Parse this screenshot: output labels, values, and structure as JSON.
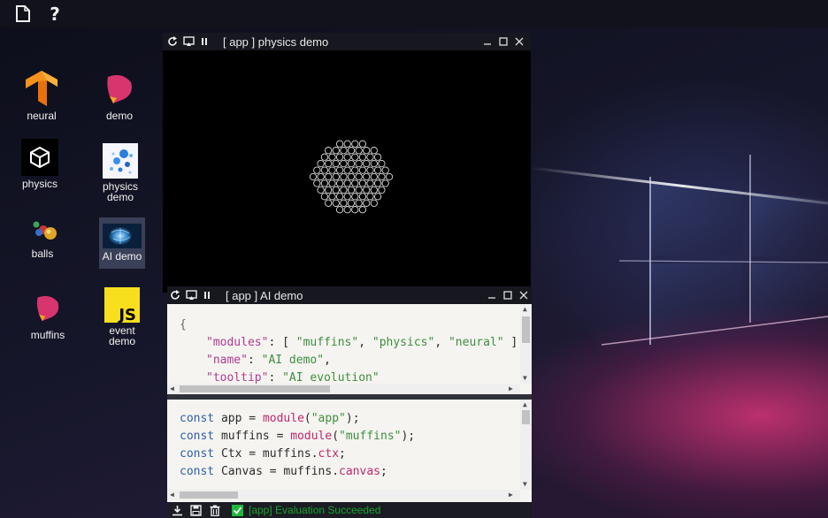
{
  "desktop": {
    "icons": [
      {
        "label": "neural",
        "icon": "tensorflow-icon"
      },
      {
        "label": "demo",
        "icon": "muffins-logo-icon"
      },
      {
        "label": "physics",
        "icon": "unity-cube-icon"
      },
      {
        "label": "physics demo",
        "icon": "particles-icon"
      },
      {
        "label": "balls",
        "icon": "balls-icon"
      },
      {
        "label": "AI demo",
        "icon": "ai-brain-icon",
        "selected": true
      },
      {
        "label": "muffins",
        "icon": "muffins-logo-icon"
      },
      {
        "label": "event demo",
        "icon": "javascript-icon"
      }
    ]
  },
  "topbar": {
    "icons": [
      "new-file-icon",
      "help-icon"
    ]
  },
  "physics_window": {
    "title": "[ app ] physics demo",
    "buttons": [
      "reload-icon",
      "cast-icon",
      "pause-icon",
      "minimize-icon",
      "maximize-icon",
      "close-icon"
    ]
  },
  "ai_window": {
    "title": "[ app ] AI demo",
    "json_lines": {
      "l1": "{",
      "l2_key": "\"modules\"",
      "l2_rest": ": [ ",
      "l2_s1": "\"muffins\"",
      "l2_c1": ", ",
      "l2_s2": "\"physics\"",
      "l2_c2": ", ",
      "l2_s3": "\"neural\"",
      "l2_end": " ],",
      "l3_key": "\"name\"",
      "l3_rest": ": ",
      "l3_val": "\"AI demo\"",
      "l3_end": ",",
      "l4_key": "\"tooltip\"",
      "l4_rest": ": ",
      "l4_val": "\"AI evolution\""
    },
    "code_lines": [
      {
        "kw": "const",
        "name": " app = ",
        "fn": "module",
        "open": "(",
        "str": "\"app\"",
        "close": ");"
      },
      {
        "kw": "const",
        "name": " muffins = ",
        "fn": "module",
        "open": "(",
        "str": "\"muffins\"",
        "close": ");"
      },
      {
        "kw": "const",
        "name": " Ctx = muffins.",
        "fn": "ctx",
        "open": "",
        "str": "",
        "close": ";"
      },
      {
        "kw": "const",
        "name": " Canvas = muffins.",
        "fn": "canvas",
        "open": "",
        "str": "",
        "close": ";"
      }
    ],
    "status": {
      "text": "[app] Evaluation Succeeded",
      "buttons": [
        "download-icon",
        "save-icon",
        "trash-icon"
      ],
      "check_icon": "check-icon"
    }
  },
  "colors": {
    "accent_success": "#18a52e",
    "titlebar": "#16171f",
    "editor_bg": "#f5f4f1"
  }
}
